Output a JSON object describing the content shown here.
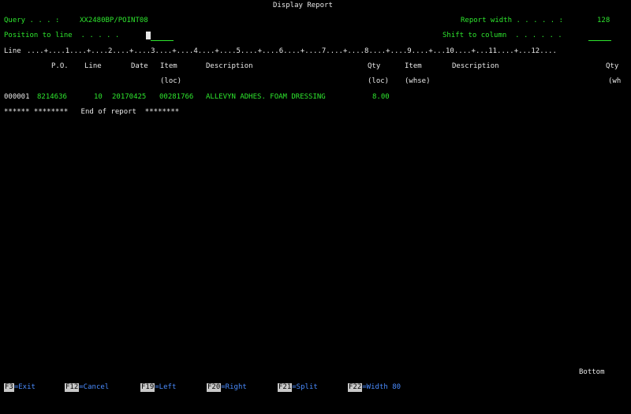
{
  "header": {
    "title": "Display Report",
    "query_label": "Query . . . :",
    "query_value": "XX2480BP/POINT08",
    "report_width_label": "Report width . . . . . :",
    "report_width_value": "128",
    "position_label": "Position to line  . . . . .",
    "shift_label": "Shift to column  . . . . . .",
    "position_value": "",
    "shift_value": ""
  },
  "ruler": {
    "label": "Line",
    "scale": "....+....1....+....2....+....3....+....4....+....5....+....6....+....7....+....8....+....9....+...10....+...11....+...12...."
  },
  "columns": {
    "po": "P.O.",
    "line": "Line",
    "date": "Date",
    "item": "Item",
    "item_sub": "(loc)",
    "desc": "Description",
    "qty": "Qty",
    "qty_sub": "(loc)",
    "item2": "Item",
    "item2_sub": "(whse)",
    "desc2": "Description",
    "qty2": "Qty",
    "qty2_sub": "(wh"
  },
  "rows": [
    {
      "seq": "000001",
      "po": "8214636",
      "line": "10",
      "date": "20170425",
      "item": "00281766",
      "desc": "ALLEVYN ADHES. FOAM DRESSING",
      "qty": "8.00"
    }
  ],
  "end_of_report": "****** ********   End of report  ********",
  "bottom_label": "Bottom",
  "function_keys": [
    {
      "key": "F3",
      "label": "=Exit"
    },
    {
      "key": "F12",
      "label": "=Cancel"
    },
    {
      "key": "F19",
      "label": "=Left"
    },
    {
      "key": "F20",
      "label": "=Right"
    },
    {
      "key": "F21",
      "label": "=Split"
    },
    {
      "key": "F22",
      "label": "=Width 80"
    }
  ]
}
